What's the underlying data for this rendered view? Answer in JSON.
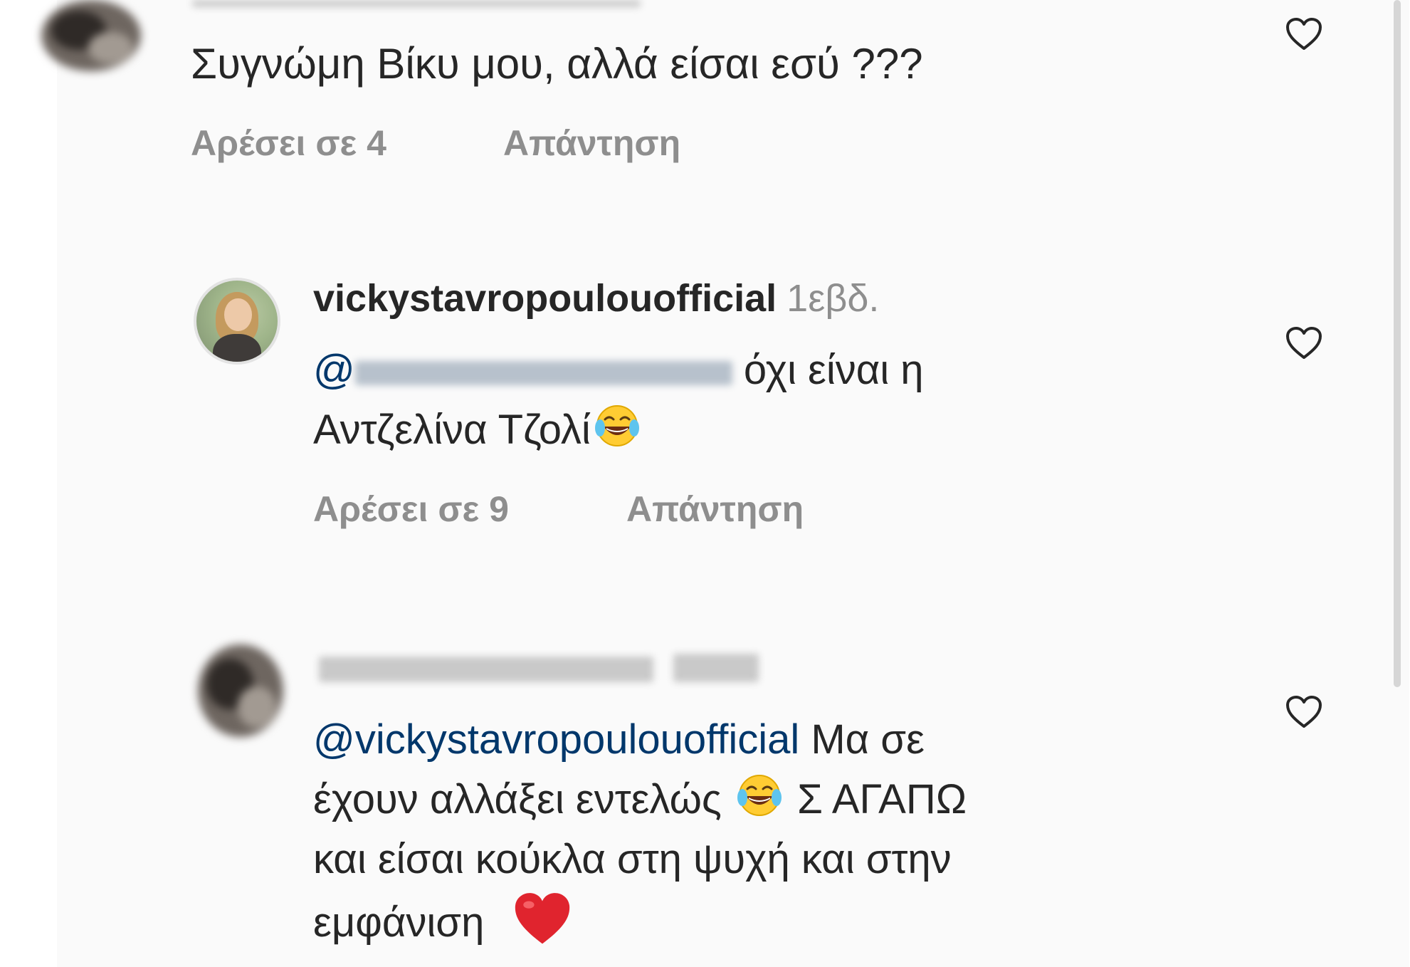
{
  "comments": [
    {
      "text": "Συγνώμη Βίκυ μου, αλλά είσαι εσύ ???",
      "likes_label": "Αρέσει σε 4",
      "reply_label": "Απάντηση"
    },
    {
      "username": "vickystavropoulouofficial",
      "timestamp": "1εβδ.",
      "mention_prefix": "@",
      "text_line1": "όχι είναι η",
      "text_line2": "Αντζελίνα Τζολί",
      "likes_label": "Αρέσει σε 9",
      "reply_label": "Απάντηση"
    },
    {
      "mention": "@vickystavropoulouofficial",
      "text_part1": " Μα σε",
      "text_part2": "έχουν αλλάξει εντελώς",
      "text_part3": " Σ ΑΓΑΠΩ",
      "text_part4": "και είσαι κούκλα στη ψυχή και στην",
      "text_part5": "εμφάνιση"
    }
  ],
  "icons": {
    "like": "heart-outline-icon",
    "laugh": "face-with-tears-of-joy-emoji",
    "love": "red-heart-emoji"
  },
  "colors": {
    "text": "#262626",
    "meta": "#8e8e8e",
    "mention": "#00376b",
    "background": "#fafafa"
  }
}
